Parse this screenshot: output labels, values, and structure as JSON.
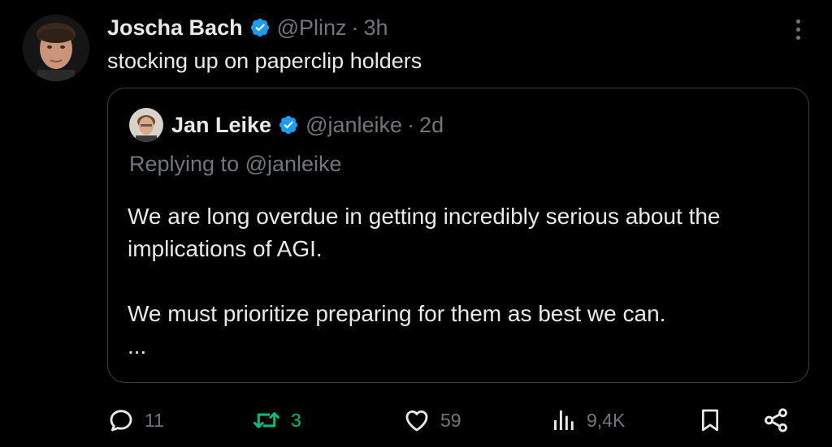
{
  "tweet": {
    "author_name": "Joscha Bach",
    "author_handle": "@Plinz",
    "separator": "·",
    "time": "3h",
    "text": "stocking up on paperclip holders"
  },
  "quoted": {
    "author_name": "Jan Leike",
    "author_handle": "@janleike",
    "separator": "·",
    "time": "2d",
    "replying_to": "Replying to @janleike",
    "paragraph_1_line_1": "We are long overdue in getting incredibly serious about the",
    "paragraph_1_line_2": "implications of AGI.",
    "paragraph_2": "We must prioritize preparing for them as best we can.",
    "ellipsis": "..."
  },
  "actions": {
    "replies": "11",
    "retweets": "3",
    "likes": "59",
    "views": "9,4K"
  },
  "colors": {
    "background": "#000000",
    "text": "#e7e9ea",
    "muted": "#71767b",
    "verified": "#1d9bf0",
    "retweet_active": "#00ba7c",
    "border": "#3a3d40"
  },
  "icons": {
    "verified": "verified-badge-icon",
    "more": "more-dots-icon",
    "reply": "reply-bubble-icon",
    "retweet": "retweet-icon",
    "like": "heart-icon",
    "views": "views-bars-icon",
    "bookmark": "bookmark-icon",
    "share": "share-icon"
  }
}
